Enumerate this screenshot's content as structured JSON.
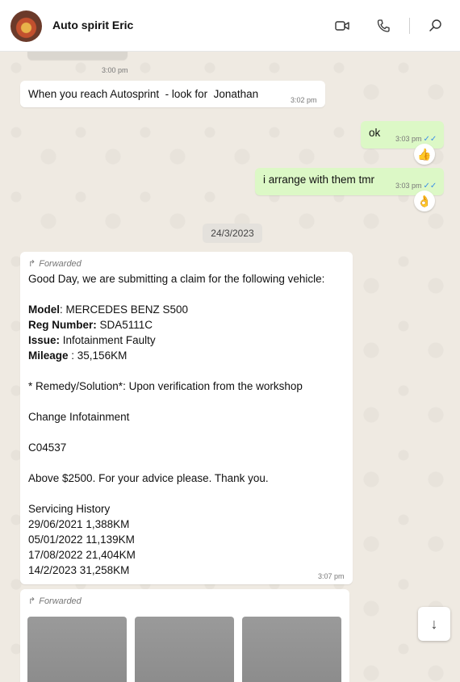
{
  "header": {
    "contact_name": "Auto spirit Eric",
    "icons": [
      "video-call-icon",
      "voice-call-icon",
      "search-icon"
    ]
  },
  "messages": {
    "top_time": "3:00 pm",
    "m1": {
      "text": "When you reach Autosprint  - look for  Jonathan",
      "time": "3:02 pm"
    },
    "m2": {
      "text": "ok",
      "time": "3:03 pm",
      "reaction": "👍"
    },
    "m3": {
      "text": "i arrange with them tmr",
      "time": "3:03 pm",
      "reaction": "👌"
    },
    "date_chip": "24/3/2023",
    "m4": {
      "forwarded_label": "Forwarded",
      "line1": "Good Day, we are submitting a claim for the following vehicle:",
      "model_label": "Model",
      "model_value": ": MERCEDES BENZ S500",
      "reg_label": "Reg Number:",
      "reg_value": " SDA5111C",
      "issue_label": "Issue:",
      "issue_value": " Infotainment Faulty",
      "mileage_label": "Mileage",
      "mileage_value": " : 35,156KM",
      "remedy": "* Remedy/Solution*: Upon verification from the workshop",
      "change": "Change Infotainment",
      "code": "C04537",
      "advice": "Above $2500. For your advice please. Thank you.",
      "history_title": "Servicing History",
      "history": [
        "29/06/2021 1,388KM",
        "05/01/2022 11,139KM",
        "17/08/2022 21,404KM",
        "14/2/2023 31,258KM"
      ],
      "time": "3:07 pm"
    },
    "m5": {
      "forwarded_label": "Forwarded"
    }
  },
  "colors": {
    "outgoing": "#dcf8c6",
    "incoming": "#ffffff",
    "background": "#efeae2",
    "read_ticks": "#3b8ee6"
  }
}
